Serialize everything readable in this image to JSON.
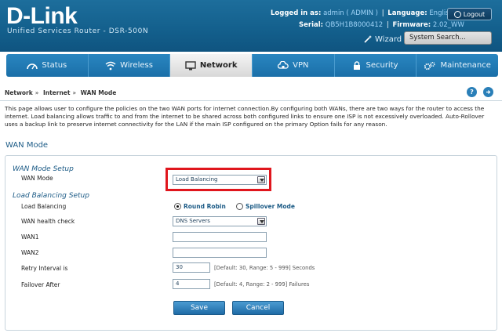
{
  "header": {
    "logo": "D-Link",
    "subtitle": "Unified Services Router - DSR-500N",
    "logged_in_label": "Logged in as:",
    "logged_in_value": "admin ( ADMIN )",
    "language_label": "Language:",
    "language_value": "English [US]",
    "serial_label": "Serial:",
    "serial_value": "QB5H1B8000412",
    "firmware_label": "Firmware:",
    "firmware_value": "2.02_WW",
    "logout": "Logout",
    "wizard": "Wizard",
    "search_placeholder": "System Search..."
  },
  "nav": [
    {
      "label": "Status",
      "icon": "gauge-icon"
    },
    {
      "label": "Wireless",
      "icon": "wifi-icon"
    },
    {
      "label": "Network",
      "icon": "monitor-icon",
      "active": true
    },
    {
      "label": "VPN",
      "icon": "cloud-lock-icon"
    },
    {
      "label": "Security",
      "icon": "lock-icon"
    },
    {
      "label": "Maintenance",
      "icon": "gears-icon"
    }
  ],
  "breadcrumb": [
    "Network",
    "Internet",
    "WAN Mode"
  ],
  "description": "This page allows user to configure the policies on the two WAN ports for internet connection.By configuring both WANs, there are two ways for the router to access the internet. Load balancing allows traffic to and from the internet to be shared across both configured links to ensure one ISP is not excessively overloaded. Auto-Rollover uses a backup link to preserve internet connectivity for the LAN if the main ISP configured on the primary Option fails for any reason.",
  "section_title": "WAN Mode",
  "wan_mode_setup": {
    "title": "WAN Mode Setup",
    "wan_mode_label": "WAN Mode",
    "wan_mode_value": "Load Balancing"
  },
  "load_balancing_setup": {
    "title": "Load Balancing Setup",
    "load_balancing_label": "Load Balancing",
    "option_round_robin": "Round Robin",
    "option_spillover": "Spillover Mode",
    "selected": "Round Robin",
    "health_check_label": "WAN health check",
    "health_check_value": "DNS Servers",
    "wan1_label": "WAN1",
    "wan1_value": "",
    "wan2_label": "WAN2",
    "wan2_value": "",
    "retry_label": "Retry Interval is",
    "retry_value": "30",
    "retry_hint": "[Default: 30, Range: 5 - 999] Seconds",
    "failover_label": "Failover After",
    "failover_value": "4",
    "failover_hint": "[Default: 4, Range: 2 - 999] Failures"
  },
  "buttons": {
    "save": "Save",
    "cancel": "Cancel"
  },
  "colors": {
    "header_blue": "#135f8c",
    "nav_blue": "#1a6fa8",
    "highlight_red": "#e0161d",
    "title_blue": "#1c5b86"
  }
}
